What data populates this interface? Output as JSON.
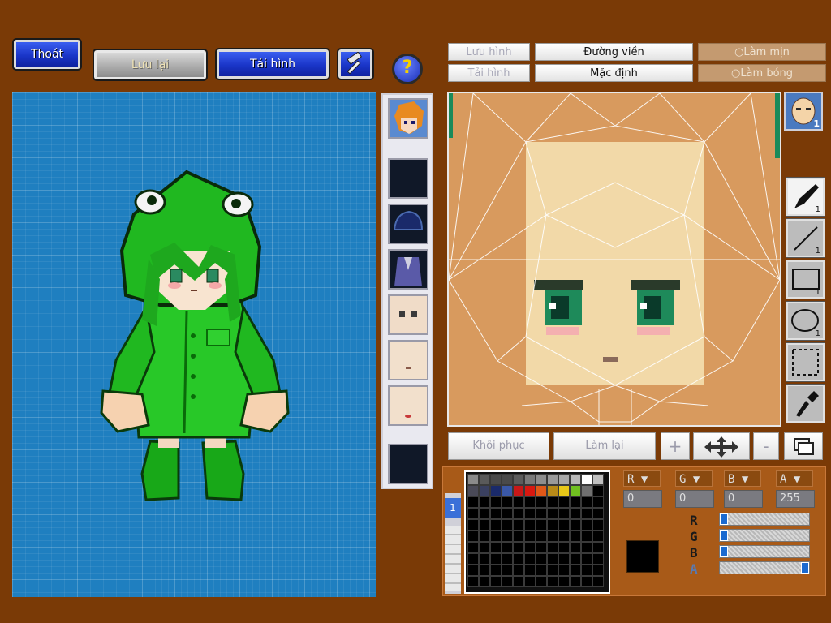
{
  "toolbar": {
    "exit_label": "Thoát",
    "save_label": "Lưu lại",
    "load_label": "Tải hình",
    "help_label": "?"
  },
  "editor_tabs": {
    "save_image": "Lưu hình",
    "outline": "Đường viền",
    "smooth": "Làm mịn",
    "load_image": "Tải hình",
    "default": "Mặc định",
    "shadow": "Làm bóng"
  },
  "face_badge": "1",
  "tools": [
    {
      "name": "brush",
      "count": "1",
      "active": true
    },
    {
      "name": "line",
      "count": "1",
      "active": false
    },
    {
      "name": "rectangle",
      "count": "1",
      "active": false
    },
    {
      "name": "ellipse",
      "count": "1",
      "active": false
    },
    {
      "name": "select",
      "count": "",
      "active": false
    },
    {
      "name": "eyedropper",
      "count": "",
      "active": false
    }
  ],
  "actions": {
    "restore": "Khôi phục",
    "redo": "Làm lại",
    "plus": "+",
    "minus": "-"
  },
  "palette": {
    "colors": [
      "#8a8a8a",
      "#5a5a5a",
      "#4a4a4a",
      "#4a4a4a",
      "#5c5c5c",
      "#7a7a7a",
      "#8e8e8e",
      "#9a9a9a",
      "#a8a8a8",
      "#b8b8b8",
      "#ffffff",
      "#c0c0c0",
      "#4a4a58",
      "#3a4060",
      "#1a2a6a",
      "#3a58a8",
      "#c81818",
      "#d81810",
      "#e05818",
      "#b88a18",
      "#e8c818",
      "#70c020",
      "#707070"
    ],
    "layer_tab": "1"
  },
  "channels": {
    "r": {
      "label": "R",
      "value": "0"
    },
    "g": {
      "label": "G",
      "value": "0"
    },
    "b": {
      "label": "B",
      "value": "0"
    },
    "a": {
      "label": "A",
      "value": "255"
    }
  },
  "sliders": [
    {
      "label": "R",
      "level": 0
    },
    {
      "label": "G",
      "level": 0
    },
    {
      "label": "B",
      "level": 0
    },
    {
      "label": "A",
      "level": 1
    }
  ],
  "current_color": "#000000"
}
